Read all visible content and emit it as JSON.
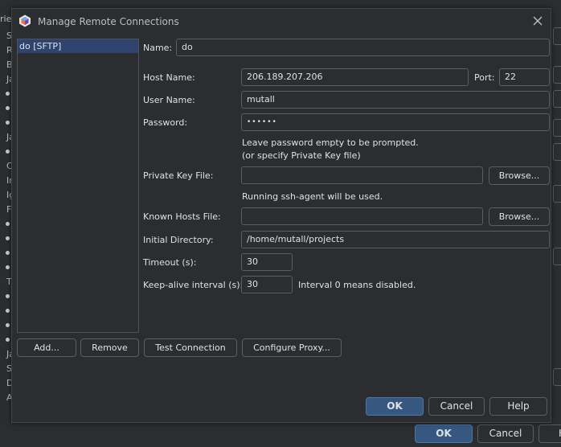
{
  "background": {
    "letters": [
      "rie",
      "S",
      "R",
      "B",
      "Ja",
      "Ja",
      "C",
      "In",
      "Ig",
      "F",
      "T",
      "Ja",
      "S",
      "D",
      "A"
    ],
    "buttons": {
      "ok": "OK",
      "cancel": "Cancel",
      "help": "H"
    }
  },
  "dialog": {
    "title": "Manage Remote Connections",
    "connections": [
      {
        "label": "do [SFTP]",
        "selected": true
      }
    ],
    "name": {
      "label": "Name:",
      "value": "do"
    },
    "host": {
      "label": "Host Name:",
      "value": "206.189.207.206"
    },
    "port": {
      "label": "Port:",
      "value": "22"
    },
    "user": {
      "label": "User Name:",
      "value": "mutall"
    },
    "password": {
      "label": "Password:",
      "value": "••••••"
    },
    "password_hint_1": "Leave password empty to be prompted.",
    "password_hint_2": "(or specify Private Key file)",
    "private_key": {
      "label": "Private Key File:",
      "value": "",
      "browse": "Browse..."
    },
    "ssh_agent_hint": "Running ssh-agent will be used.",
    "known_hosts": {
      "label": "Known Hosts File:",
      "value": "",
      "browse": "Browse..."
    },
    "initial_dir": {
      "label": "Initial Directory:",
      "value": "/home/mutall/projects"
    },
    "timeout": {
      "label": "Timeout (s):",
      "value": "30"
    },
    "keepalive": {
      "label": "Keep-alive interval (s):",
      "value": "30",
      "hint": "Interval 0 means disabled."
    },
    "buttons": {
      "add": "Add...",
      "remove": "Remove",
      "test": "Test Connection",
      "proxy": "Configure Proxy...",
      "ok": "OK",
      "cancel": "Cancel",
      "help": "Help"
    }
  },
  "colors": {
    "background": "#2b2d30",
    "selection": "#2e436e",
    "primary_button": "#365880",
    "border": "#5a5d63"
  }
}
